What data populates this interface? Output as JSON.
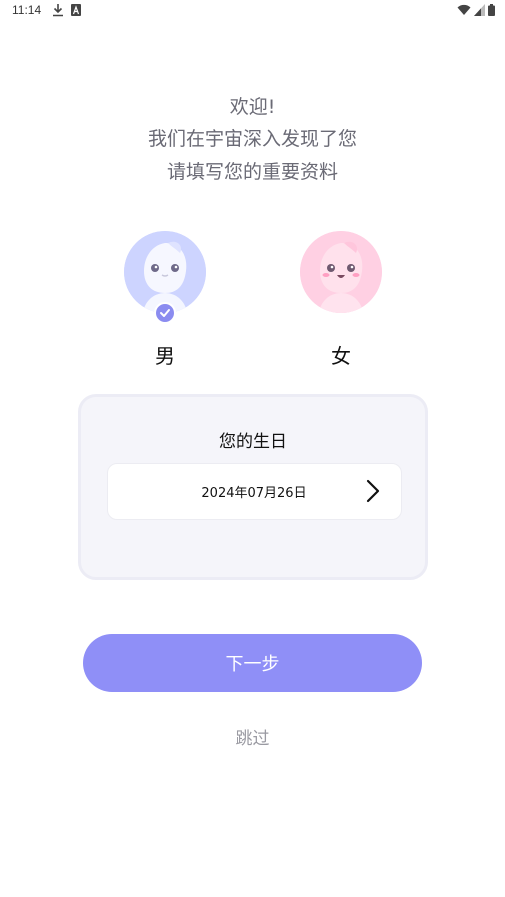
{
  "status_bar": {
    "time": "11:14",
    "icons": [
      "download-icon",
      "a-icon",
      "wifi-icon",
      "signal-icon",
      "battery-icon"
    ]
  },
  "welcome": {
    "line1": "欢迎!",
    "line2": "我们在宇宙深入发现了您",
    "line3": "请填写您的重要资料"
  },
  "gender": {
    "male_label": "男",
    "female_label": "女",
    "selected": "male"
  },
  "birthday": {
    "title": "您的生日",
    "value": "2024年07月26日"
  },
  "actions": {
    "next_label": "下一步",
    "skip_label": "跳过"
  },
  "colors": {
    "accent": "#8f8ff7",
    "male_avatar_bg": "#cfd6ff",
    "female_avatar_bg": "#ffd3e6",
    "card_bg": "#f5f5fa"
  }
}
